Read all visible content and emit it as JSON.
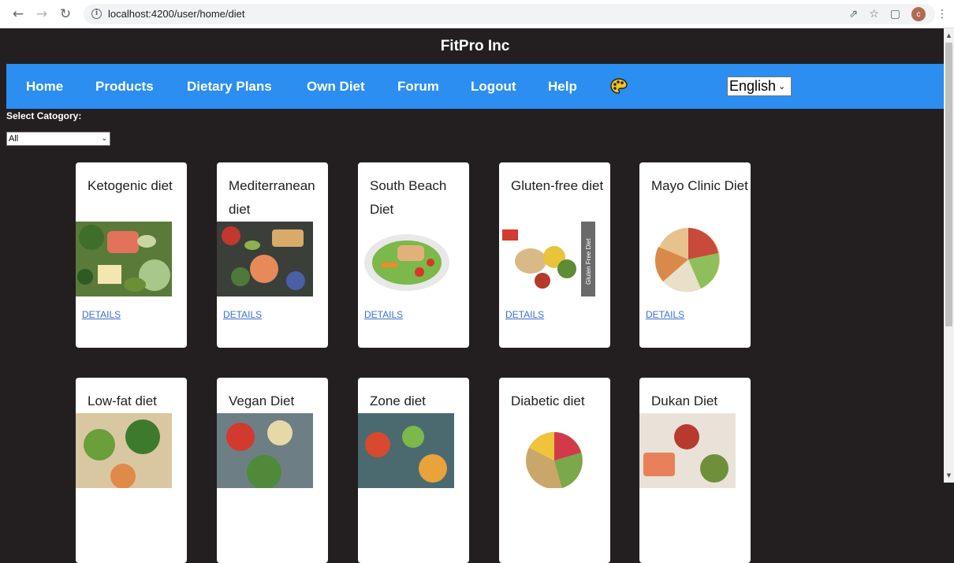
{
  "browser": {
    "url": "localhost:4200/user/home/diet",
    "avatar_letter": "c"
  },
  "header": {
    "brand": "FitPro Inc"
  },
  "nav": {
    "items": [
      "Home",
      "Products",
      "Dietary Plans",
      "Own Diet",
      "Forum",
      "Logout",
      "Help"
    ],
    "language": "English"
  },
  "category": {
    "label": "Select Catogory:",
    "selected": "All"
  },
  "diets": [
    {
      "title": "Ketogenic diet",
      "link": "DETAILS"
    },
    {
      "title": "Mediterranean diet",
      "link": "DETAILS"
    },
    {
      "title": "South Beach Diet",
      "link": "DETAILS"
    },
    {
      "title": "Gluten-free diet",
      "link": "DETAILS",
      "image_text": "Gluten Free Diet"
    },
    {
      "title": "Mayo Clinic Diet",
      "link": "DETAILS"
    },
    {
      "title": "Low-fat diet"
    },
    {
      "title": "Vegan Diet"
    },
    {
      "title": "Zone diet"
    },
    {
      "title": "Diabetic diet"
    },
    {
      "title": "Dukan Diet"
    }
  ],
  "colors": {
    "nav_bar": "#2b8ef0",
    "page_bg": "#231f20",
    "link": "#3b6fd4"
  }
}
